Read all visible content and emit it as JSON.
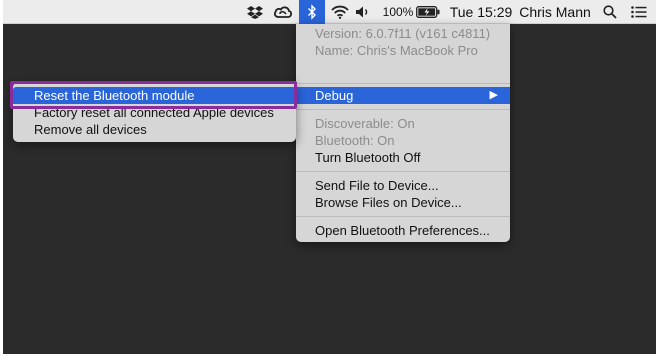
{
  "menubar": {
    "battery_percent": "100%",
    "clock": "Tue 15:29",
    "user_name": "Chris Mann",
    "icons": [
      "dropbox-icon",
      "creative-cloud-icon",
      "bluetooth-icon",
      "wifi-icon",
      "volume-icon",
      "battery-icon",
      "spotlight-search-icon",
      "notification-center-icon"
    ]
  },
  "bluetooth_menu": {
    "version": "Version: 6.0.7f11 (v161 c4811)",
    "name": "Name: Chris's MacBook Pro",
    "debug_label": "Debug",
    "discoverable": "Discoverable: On",
    "bluetooth_status": "Bluetooth: On",
    "turn_off": "Turn Bluetooth Off",
    "send_file": "Send File to Device...",
    "browse_files": "Browse Files on Device...",
    "open_prefs": "Open Bluetooth Preferences..."
  },
  "debug_submenu": {
    "items": [
      "Reset the Bluetooth module",
      "Factory reset all connected Apple devices",
      "Remove all devices"
    ]
  },
  "colors": {
    "highlight": "#2a64d9",
    "annotation_border": "#8a2c9b",
    "desktop": "#2b2b2b",
    "menu_bg": "#d6d6d6"
  }
}
